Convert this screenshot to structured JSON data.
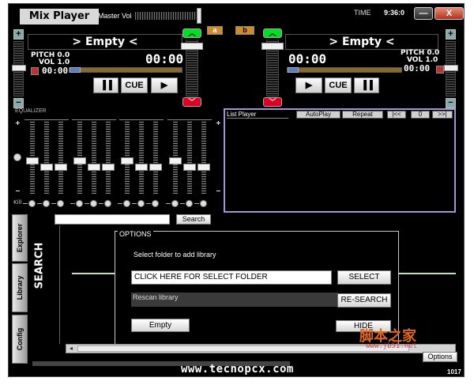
{
  "app": {
    "title": "Mix Player",
    "master_vol_label": "Master Vol",
    "time_label": "TIME",
    "time_value": "9:36:0",
    "minimize_symbol": "—",
    "close_symbol": "X",
    "badge_left": "a",
    "badge_right": "b"
  },
  "deck_left": {
    "title": "> Empty <",
    "pitch": "PITCH 0.0",
    "vol": "VOL 1.0",
    "time": "00:00",
    "small_time": "00:00",
    "buttons": {
      "pause": "▐▐",
      "cue": "CUE",
      "play": "▶"
    },
    "plus": "+",
    "minus": "−"
  },
  "deck_right": {
    "title": "> Empty <",
    "pitch": "PITCH 0.0",
    "vol": "VOL 1.0",
    "time": "00:00",
    "small_time": "00:00",
    "buttons": {
      "play": "▶",
      "cue": "CUE",
      "pause": "▐▐"
    },
    "plus": "+",
    "minus": "−"
  },
  "equalizer": {
    "label": "EQUALIZER",
    "kill_label": "Kill",
    "plus": "+",
    "minus": "−"
  },
  "list_player": {
    "title": "List Player",
    "autoplay": "AutoPlay",
    "repeat": "Repeat",
    "prev": "|<<",
    "count": "0",
    "next": ">>|"
  },
  "search": {
    "button": "Search",
    "input_value": "",
    "vertical_label": "SEARCH"
  },
  "side_tabs": [
    "Explorer",
    "Library",
    "Config"
  ],
  "options": {
    "title": "OPTIONS",
    "instruction": "Select folder to add library",
    "folder_field": "CLICK HERE FOR SELECT FOLDER",
    "select_button": "SELECT",
    "rescan_label": "Rescan library",
    "research_button": "RE-SEARCH",
    "empty_button": "Empty",
    "hide_button": "HIDE",
    "options_button": "Options"
  },
  "footer": {
    "site": "www.tecnopcx.com",
    "version": "1017"
  },
  "watermark": {
    "main": "脚本之家",
    "sub": "www.jb51.net"
  },
  "arrows": {
    "up": "︿",
    "down": "﹀"
  }
}
